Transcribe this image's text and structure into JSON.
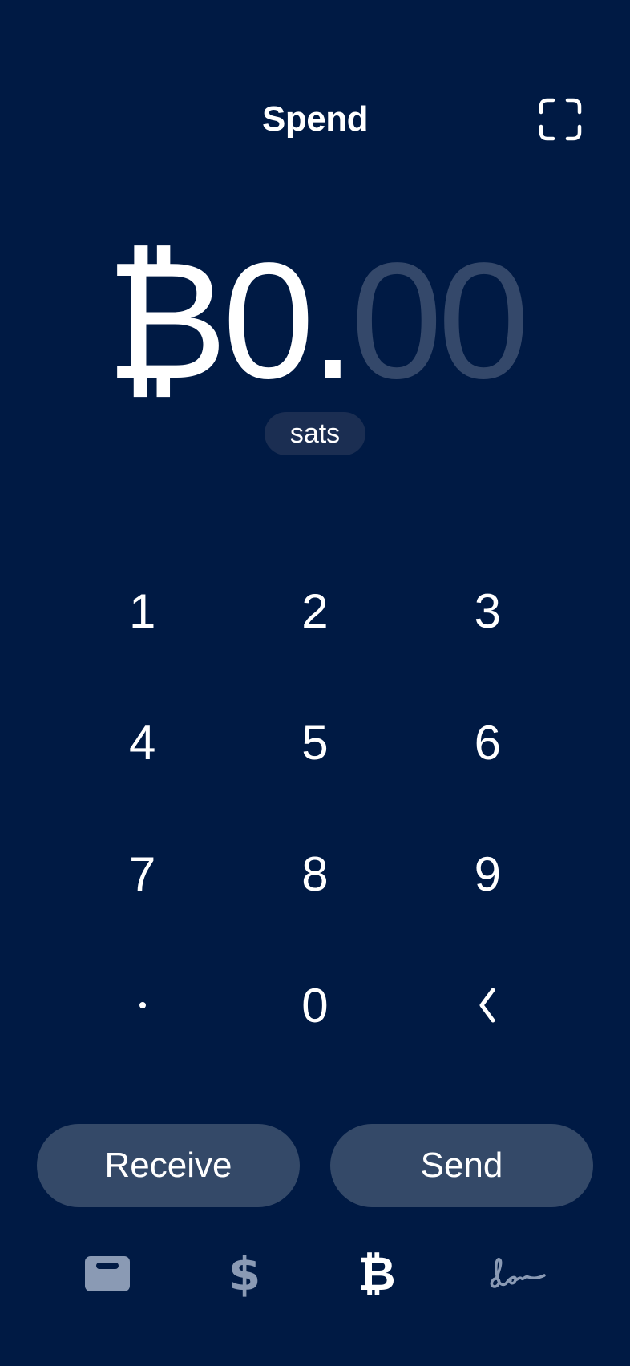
{
  "header": {
    "title": "Spend",
    "scan_icon": "scan-qr-icon"
  },
  "amount": {
    "symbol": "₿",
    "integer": "0",
    "separator": ".",
    "decimals": "00"
  },
  "unit": {
    "label": "sats"
  },
  "keypad": {
    "keys": [
      "1",
      "2",
      "3",
      "4",
      "5",
      "6",
      "7",
      "8",
      "9",
      "·",
      "0",
      "‹"
    ],
    "dot_icon": "decimal-point-icon",
    "backspace_icon": "backspace-chevron-icon"
  },
  "actions": {
    "receive_label": "Receive",
    "send_label": "Send"
  },
  "tabbar": {
    "items": [
      {
        "icon": "card-icon",
        "active": false
      },
      {
        "icon": "dollar-icon",
        "glyph": "$",
        "active": false
      },
      {
        "icon": "bitcoin-icon",
        "glyph": "₿",
        "active": true
      },
      {
        "icon": "signature-icon",
        "active": false
      }
    ]
  },
  "colors": {
    "background": "#001a44",
    "faded_digits": "#34486a",
    "pill_background": "#1b2e52",
    "button_background": "#344968",
    "tab_inactive": "#8a9ab4",
    "tab_active": "#ffffff"
  }
}
